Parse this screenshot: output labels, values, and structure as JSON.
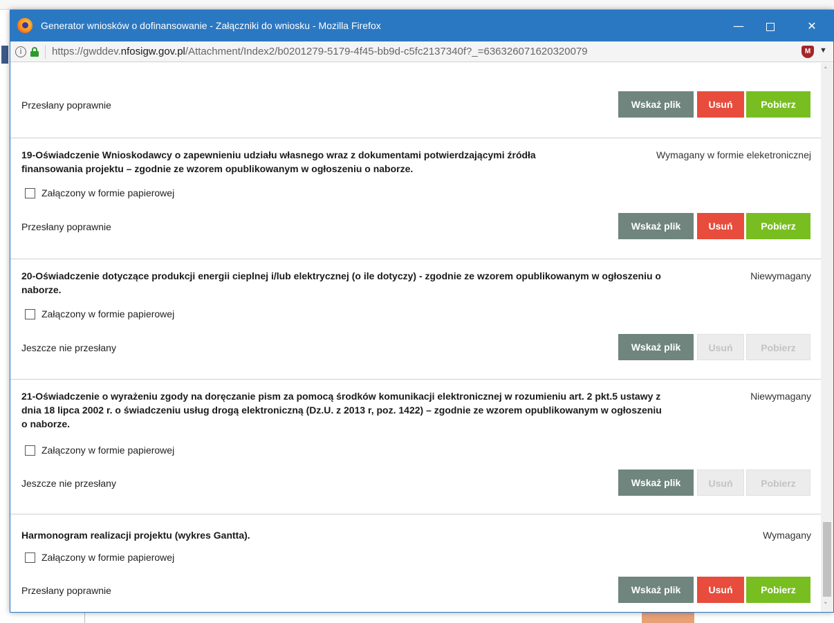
{
  "window": {
    "title": "Generator wniosków o dofinansowanie - Załączniki do wniosku - Mozilla Firefox",
    "min_glyph": "—",
    "close_glyph": "✕"
  },
  "urlbar": {
    "url_prefix": "https://gwddev.",
    "url_domain": "nfosigw.gov.pl",
    "url_suffix": "/Attachment/Index2/b0201279-5179-4f45-bb9d-c5fc2137340f?_=636326071620320079"
  },
  "buttons": {
    "wskaz": "Wskaż plik",
    "usun": "Usuń",
    "pobierz": "Pobierz"
  },
  "checkbox_label": "Załączony w formie papierowej",
  "sections": [
    {
      "status": "Przesłany poprawnie",
      "usun_enabled": true,
      "pobierz_enabled": true
    },
    {
      "title_line1": "19-Oświadczenie Wnioskodawcy o zapewnieniu udziału własnego wraz z dokumentami potwierdzającymi źródła",
      "title_line2": "finansowania projektu – zgodnie ze wzorem opublikowanym w ogłoszeniu o naborze.",
      "requirement": "Wymagany w formie eleketronicznej",
      "checked": false,
      "status": "Przesłany poprawnie",
      "usun_enabled": true,
      "pobierz_enabled": true
    },
    {
      "title_line1": "20-Oświadczenie dotyczące produkcji energii cieplnej i/lub elektrycznej (o ile dotyczy) - zgodnie ze wzorem opublikowanym w ogłoszeniu o",
      "title_line2": "naborze.",
      "requirement": "Niewymagany",
      "checked": false,
      "status": "Jeszcze nie przesłany",
      "usun_enabled": false,
      "pobierz_enabled": false
    },
    {
      "title_line1": "21-Oświadczenie o wyrażeniu zgody na doręczanie pism za pomocą środków komunikacji elektronicznej w rozumieniu art. 2 pkt.5 ustawy z",
      "title_line2": "dnia 18 lipca 2002 r. o świadczeniu usług drogą elektroniczną (Dz.U. z 2013 r, poz. 1422) – zgodnie ze wzorem opublikowanym w ogłoszeniu",
      "title_line3": "o naborze.",
      "requirement": "Niewymagany",
      "checked": false,
      "status": "Jeszcze nie przesłany",
      "usun_enabled": false,
      "pobierz_enabled": false
    },
    {
      "title_line1": "Harmonogram realizacji projektu (wykres Gantta).",
      "requirement": "Wymagany",
      "checked": false,
      "status": "Przesłany poprawnie",
      "usun_enabled": true,
      "pobierz_enabled": true
    }
  ]
}
